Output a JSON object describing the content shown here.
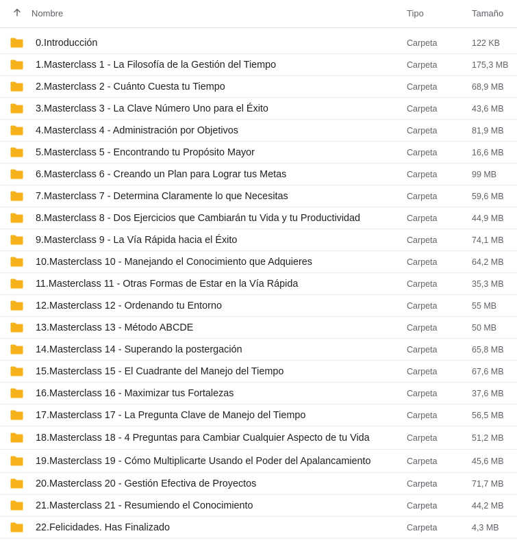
{
  "header": {
    "sort_icon": "arrow-up-icon",
    "name_label": "Nombre",
    "type_label": "Tipo",
    "size_label": "Tamaño"
  },
  "colors": {
    "folder": "#f5b21b",
    "text": "#202124",
    "muted": "#5f6368",
    "divider": "#ececec"
  },
  "rows": [
    {
      "name": "0.Introducción",
      "type": "Carpeta",
      "size": "122 KB"
    },
    {
      "name": "1.Masterclass 1 - La Filosofía de la Gestión del Tiempo",
      "type": "Carpeta",
      "size": "175,3 MB"
    },
    {
      "name": "2.Masterclass 2 - Cuánto Cuesta tu Tiempo",
      "type": "Carpeta",
      "size": "68,9 MB"
    },
    {
      "name": "3.Masterclass 3 - La Clave Número Uno para el Éxito",
      "type": "Carpeta",
      "size": "43,6 MB"
    },
    {
      "name": "4.Masterclass 4 - Administración por Objetivos",
      "type": "Carpeta",
      "size": "81,9 MB"
    },
    {
      "name": "5.Masterclass 5 - Encontrando tu Propósito Mayor",
      "type": "Carpeta",
      "size": "16,6 MB"
    },
    {
      "name": "6.Masterclass 6 - Creando un Plan para Lograr tus Metas",
      "type": "Carpeta",
      "size": "99 MB"
    },
    {
      "name": "7.Masterclass 7 - Determina Claramente lo que Necesitas",
      "type": "Carpeta",
      "size": "59,6 MB"
    },
    {
      "name": "8.Masterclass 8 - Dos Ejercicios que Cambiarán tu Vida y tu Productividad",
      "type": "Carpeta",
      "size": "44,9 MB"
    },
    {
      "name": "9.Masterclass 9 - La Vía Rápida hacia el Éxito",
      "type": "Carpeta",
      "size": "74,1 MB"
    },
    {
      "name": "10.Masterclass 10 - Manejando el Conocimiento que Adquieres",
      "type": "Carpeta",
      "size": "64,2 MB"
    },
    {
      "name": "11.Masterclass 11 - Otras Formas de Estar en la Vía Rápida",
      "type": "Carpeta",
      "size": "35,3 MB"
    },
    {
      "name": "12.Masterclass 12 - Ordenando tu Entorno",
      "type": "Carpeta",
      "size": "55 MB"
    },
    {
      "name": "13.Masterclass 13 - Método ABCDE",
      "type": "Carpeta",
      "size": "50 MB"
    },
    {
      "name": "14.Masterclass 14 - Superando la postergación",
      "type": "Carpeta",
      "size": "65,8 MB"
    },
    {
      "name": "15.Masterclass 15 - El Cuadrante del Manejo del Tiempo",
      "type": "Carpeta",
      "size": "67,6 MB"
    },
    {
      "name": "16.Masterclass 16 - Maximizar tus Fortalezas",
      "type": "Carpeta",
      "size": "37,6 MB"
    },
    {
      "name": "17.Masterclass 17 - La Pregunta Clave de Manejo del Tiempo",
      "type": "Carpeta",
      "size": "56,5 MB"
    },
    {
      "name": "18.Masterclass 18 - 4 Preguntas para Cambiar Cualquier Aspecto de tu Vida",
      "type": "Carpeta",
      "size": "51,2 MB"
    },
    {
      "name": "19.Masterclass 19 - Cómo Multiplicarte Usando el Poder del Apalancamiento",
      "type": "Carpeta",
      "size": "45,6 MB"
    },
    {
      "name": "20.Masterclass 20 - Gestión Efectiva de Proyectos",
      "type": "Carpeta",
      "size": "71,7 MB"
    },
    {
      "name": "21.Masterclass 21 - Resumiendo el Conocimiento",
      "type": "Carpeta",
      "size": "44,2 MB"
    },
    {
      "name": "22.Felicidades. Has Finalizado",
      "type": "Carpeta",
      "size": "4,3 MB"
    }
  ]
}
